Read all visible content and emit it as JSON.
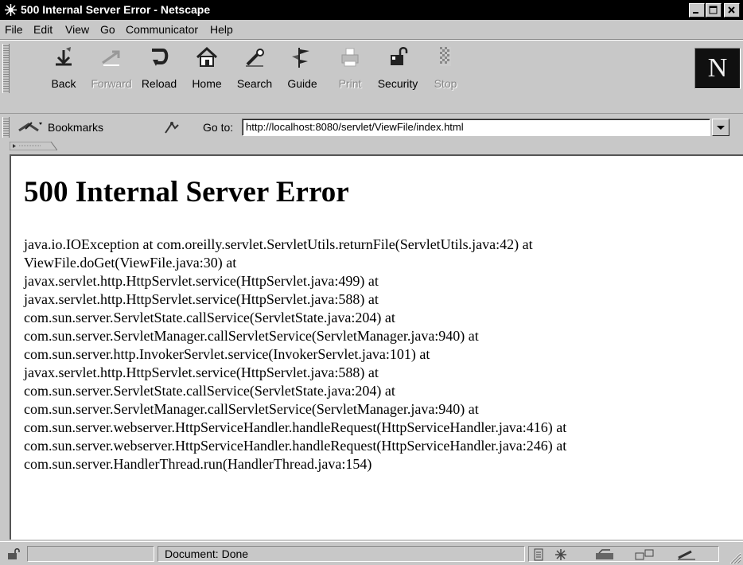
{
  "window": {
    "title": "500 Internal Server Error - Netscape"
  },
  "menu": {
    "items": [
      "File",
      "Edit",
      "View",
      "Go",
      "Communicator",
      "Help"
    ]
  },
  "toolbar": {
    "buttons": [
      {
        "label": "Back",
        "icon": "back-arrow-icon",
        "enabled": true
      },
      {
        "label": "Forward",
        "icon": "forward-arrow-icon",
        "enabled": false
      },
      {
        "label": "Reload",
        "icon": "reload-icon",
        "enabled": true
      },
      {
        "label": "Home",
        "icon": "home-icon",
        "enabled": true
      },
      {
        "label": "Search",
        "icon": "search-icon",
        "enabled": true
      },
      {
        "label": "Guide",
        "icon": "guide-icon",
        "enabled": true
      },
      {
        "label": "Print",
        "icon": "print-icon",
        "enabled": false
      },
      {
        "label": "Security",
        "icon": "lock-icon",
        "enabled": true
      },
      {
        "label": "Stop",
        "icon": "stop-icon",
        "enabled": false
      }
    ],
    "logo_letter": "N"
  },
  "location": {
    "bookmarks_label": "Bookmarks",
    "goto_label": "Go to:",
    "url": "http://localhost:8080/servlet/ViewFile/index.html"
  },
  "page": {
    "heading": "500 Internal Server Error",
    "trace_lines": [
      "java.io.IOException at com.oreilly.servlet.ServletUtils.returnFile(ServletUtils.java:42) at",
      "ViewFile.doGet(ViewFile.java:30) at",
      "javax.servlet.http.HttpServlet.service(HttpServlet.java:499) at",
      "javax.servlet.http.HttpServlet.service(HttpServlet.java:588) at",
      "com.sun.server.ServletState.callService(ServletState.java:204) at",
      "com.sun.server.ServletManager.callServletService(ServletManager.java:940) at",
      "com.sun.server.http.InvokerServlet.service(InvokerServlet.java:101) at",
      "javax.servlet.http.HttpServlet.service(HttpServlet.java:588) at",
      "com.sun.server.ServletState.callService(ServletState.java:204) at",
      "com.sun.server.ServletManager.callServletService(ServletManager.java:940) at",
      "com.sun.server.webserver.HttpServiceHandler.handleRequest(HttpServiceHandler.java:416) at",
      "com.sun.server.webserver.HttpServiceHandler.handleRequest(HttpServiceHandler.java:246) at",
      "com.sun.server.HandlerThread.run(HandlerThread.java:154)"
    ]
  },
  "status": {
    "text": "Document: Done"
  },
  "colors": {
    "titlebar": "#000000",
    "chrome": "#c8c8c8",
    "content_bg": "#ffffff"
  }
}
